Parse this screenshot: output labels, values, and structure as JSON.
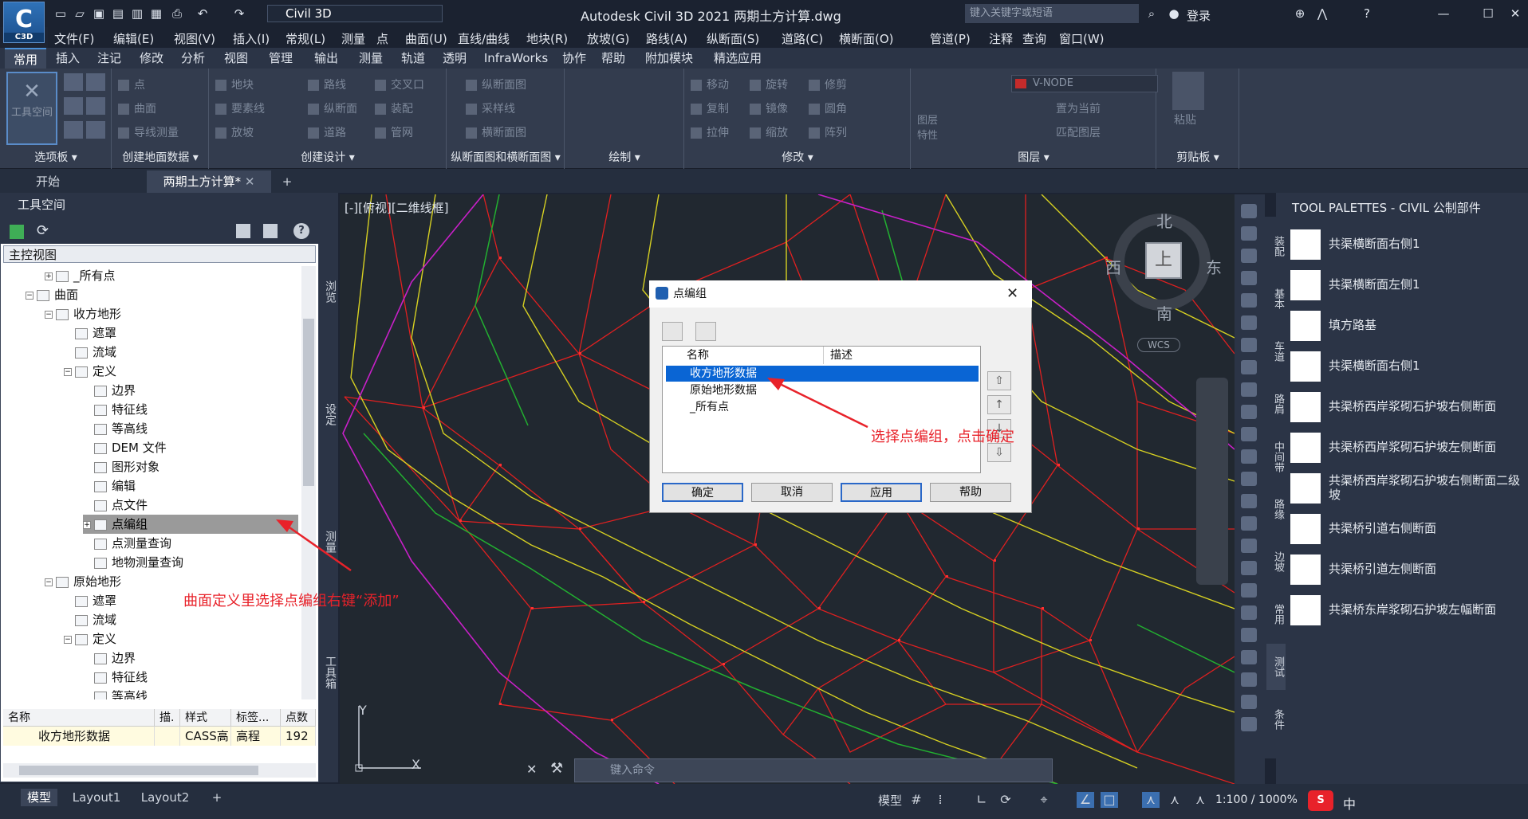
{
  "app": {
    "badge": "C3D",
    "workspace": "Civil 3D",
    "title": "Autodesk Civil 3D 2021    两期土方计算.dwg",
    "search_placeholder": "键入关键字或短语",
    "login": "登录"
  },
  "menu": [
    "文件(F)",
    "编辑(E)",
    "视图(V)",
    "插入(I)",
    "常规(L)",
    "测量",
    "点",
    "曲面(U)",
    "直线/曲线",
    "地块(R)",
    "放坡(G)",
    "路线(A)",
    "纵断面(S)",
    "道路(C)",
    "横断面(O)",
    "管道(P)",
    "注释",
    "查询",
    "窗口(W)"
  ],
  "ribbon_tabs": [
    "常用",
    "插入",
    "注记",
    "修改",
    "分析",
    "视图",
    "管理",
    "输出",
    "测量",
    "轨道",
    "透明",
    "InfraWorks",
    "协作",
    "帮助",
    "附加模块",
    "精选应用"
  ],
  "ribbon": {
    "toolspace": "工具空间",
    "p1": [
      "点",
      "曲面",
      "导线测量"
    ],
    "p2": [
      "地块",
      "要素线",
      "放坡"
    ],
    "p3": [
      "路线",
      "纵断面",
      "道路"
    ],
    "p4": [
      "交叉口",
      "装配",
      "管网"
    ],
    "p5": [
      "纵断面图",
      "采样线",
      "横断面图"
    ],
    "p6": [
      "移动",
      "旋转",
      "修剪",
      "复制",
      "镜像",
      "圆角",
      "拉伸",
      "缩放",
      "阵列"
    ],
    "p7": [
      "V-NODE",
      "置为当前",
      "匹配图层",
      "图层特性"
    ],
    "p8": [
      "粘贴"
    ],
    "titles": [
      "选项板",
      "创建地面数据",
      "创建设计",
      "纵断面图和横断面图",
      "绘制",
      "修改",
      "图层",
      "剪贴板"
    ]
  },
  "doc_tabs": [
    "开始",
    "两期土方计算*"
  ],
  "toolspace": {
    "title": "工具空间",
    "combo": "主控视图",
    "tree": [
      "_所有点",
      "曲面",
      "收方地形",
      "遮罩",
      "流域",
      "定义",
      "边界",
      "特征线",
      "等高线",
      "DEM 文件",
      "图形对象",
      "编辑",
      "点文件",
      "点编组",
      "点测量查询",
      "地物测量查询",
      "原始地形",
      "遮罩",
      "流域",
      "定义",
      "边界",
      "特征线",
      "等高线"
    ],
    "grid_headers": [
      "名称",
      "描.",
      "样式",
      "标签...",
      "点数"
    ],
    "grid_row": [
      "收方地形数据",
      "",
      "CASS高",
      "高程",
      "192"
    ]
  },
  "side_tabs": [
    "浏览",
    "设定",
    "测量",
    "工具箱"
  ],
  "viewport": {
    "label": "[-][俯视][二维线框]",
    "north": "北",
    "south": "南",
    "east": "东",
    "west": "西",
    "cube_face": "上",
    "wcs": "WCS",
    "ucs_x": "X",
    "ucs_y": "Y"
  },
  "dialog": {
    "title": "点编组",
    "col_name": "名称",
    "col_desc": "描述",
    "items": [
      "收方地形数据",
      "原始地形数据",
      "_所有点"
    ],
    "selected_index": 0,
    "buttons": [
      "确定",
      "取消",
      "应用",
      "帮助"
    ]
  },
  "annotations": {
    "a1": "选择点编组，点击确定",
    "a2": "曲面定义里选择点编组右键“添加”"
  },
  "command": {
    "placeholder": "键入命令"
  },
  "palette": {
    "title": "TOOL PALETTES - CIVIL 公制部件",
    "tabs": [
      "装配",
      "基本",
      "车道",
      "路肩",
      "中间带",
      "路缘",
      "边坡",
      "常用",
      "测试",
      "条件"
    ],
    "items": [
      "共渠横断面右侧1",
      "共渠横断面左侧1",
      "填方路基",
      "共渠横断面右侧1",
      "共渠桥西岸浆砌石护坡右侧断面",
      "共渠桥西岸浆砌石护坡左侧断面",
      "共渠桥西岸浆砌石护坡右侧断面二级坡",
      "共渠桥引道右侧断面",
      "共渠桥引道左侧断面",
      "共渠桥东岸浆砌石护坡左幅断面"
    ]
  },
  "status": {
    "tabs": [
      "模型",
      "Layout1",
      "Layout2"
    ],
    "model": "模型",
    "scale": "1:100 / 1000%",
    "ime": "中"
  },
  "colors": {
    "accent": "#2a68c8",
    "annotation": "#e8222a",
    "selection": "#0a65d4"
  }
}
